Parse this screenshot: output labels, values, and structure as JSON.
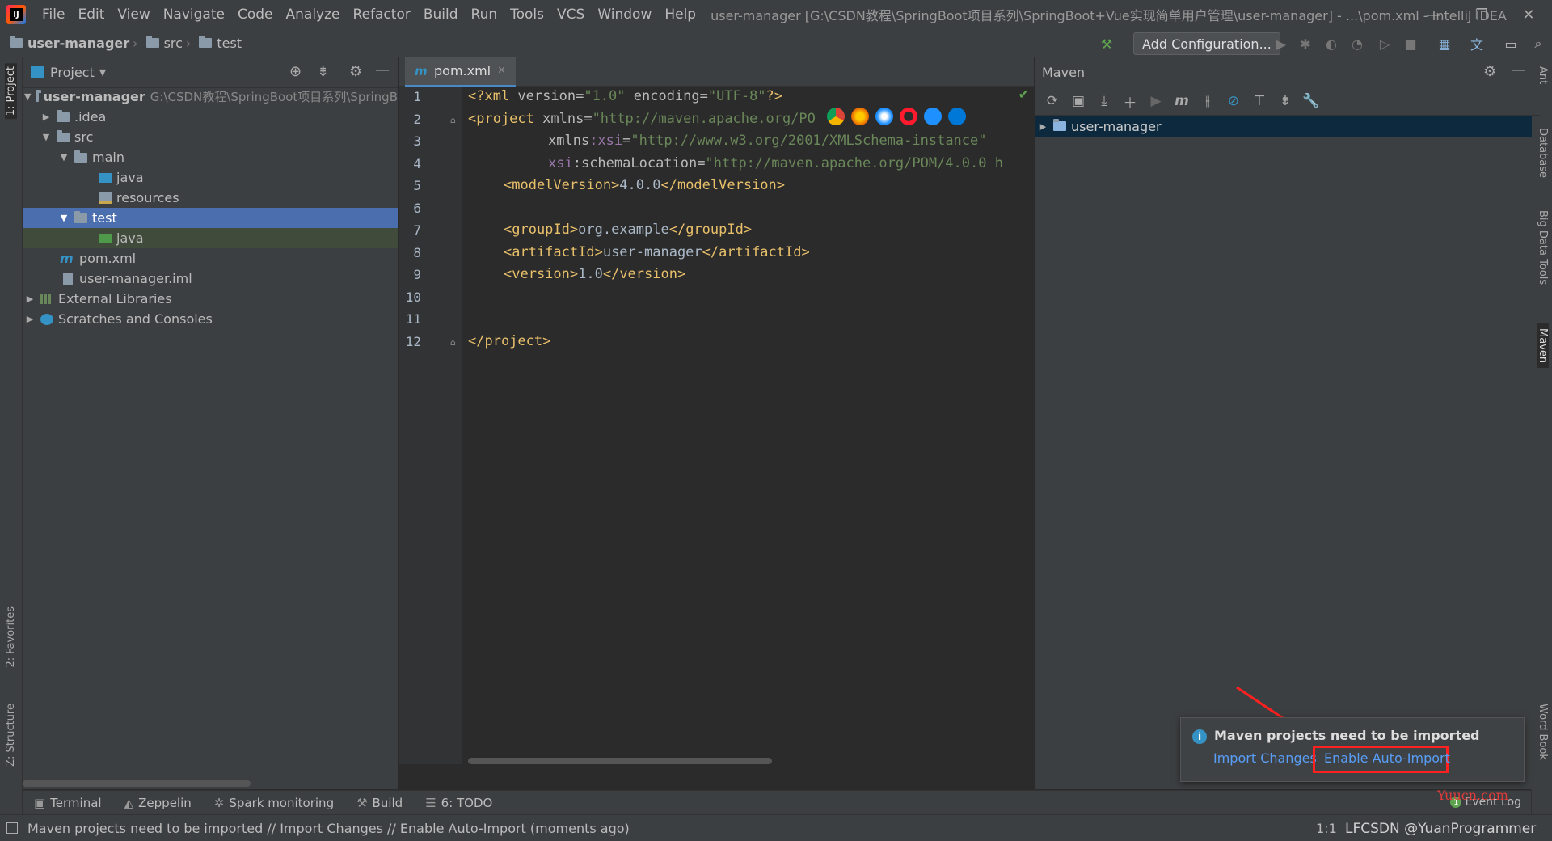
{
  "app": {
    "title": "user-manager [G:\\CSDN教程\\SpringBoot项目系列\\SpringBoot+Vue实现简单用户管理\\user-manager] - ...\\pom.xml - IntelliJ IDEA",
    "logo_text": "IJ"
  },
  "menu": [
    "File",
    "Edit",
    "View",
    "Navigate",
    "Code",
    "Analyze",
    "Refactor",
    "Build",
    "Run",
    "Tools",
    "VCS",
    "Window",
    "Help"
  ],
  "window_controls": [
    "—",
    "❐",
    "✕"
  ],
  "breadcrumb": [
    "user-manager",
    "src",
    "test"
  ],
  "toolbar": {
    "add_configuration": "Add Configuration..."
  },
  "left_stripe": {
    "project": "1: Project",
    "favorites": "2: Favorites",
    "structure": "Z: Structure"
  },
  "right_stripe": {
    "ant": "Ant",
    "database": "Database",
    "bigdata": "Big Data Tools",
    "maven": "Maven",
    "wordbook": "Word Book"
  },
  "project_panel": {
    "title": "Project",
    "tree": [
      {
        "label": "user-manager",
        "path": "G:\\CSDN教程\\SpringBoot项目系列\\SpringB"
      },
      {
        "label": ".idea"
      },
      {
        "label": "src"
      },
      {
        "label": "main"
      },
      {
        "label": "java"
      },
      {
        "label": "resources"
      },
      {
        "label": "test"
      },
      {
        "label": "java"
      },
      {
        "label": "pom.xml"
      },
      {
        "label": "user-manager.iml"
      },
      {
        "label": "External Libraries"
      },
      {
        "label": "Scratches and Consoles"
      }
    ]
  },
  "editor": {
    "tab": "pom.xml",
    "line_numbers": [
      "1",
      "2",
      "3",
      "4",
      "5",
      "6",
      "7",
      "8",
      "9",
      "10",
      "11",
      "12"
    ],
    "lines": {
      "l1": {
        "a": "<?xml ",
        "b": "version",
        "c": "=",
        "d": "\"1.0\"",
        "e": " encoding",
        "f": "=",
        "g": "\"UTF-8\"",
        "h": "?>"
      },
      "l2": {
        "a": "<project ",
        "b": "xmlns",
        "c": "=",
        "d": "\"http://maven.apache.org/PO"
      },
      "l3": {
        "a": "xmlns",
        "b": ":xsi",
        "c": "=",
        "d": "\"http://www.w3.org/2001/XMLSchema-instance\""
      },
      "l4": {
        "a": "xsi",
        "b": ":schemaLocation",
        "c": "=",
        "d": "\"http://maven.apache.org/POM/4.0.0 h"
      },
      "l5": {
        "a": "<modelVersion>",
        "b": "4.0.0",
        "c": "</modelVersion>"
      },
      "l7": {
        "a": "<groupId>",
        "b": "org.example",
        "c": "</groupId>"
      },
      "l8": {
        "a": "<artifactId>",
        "b": "user-manager",
        "c": "</artifactId>"
      },
      "l9": {
        "a": "<version>",
        "b": "1.0",
        "c": "</version>"
      },
      "l12": {
        "a": "</project>"
      }
    }
  },
  "maven_panel": {
    "title": "Maven",
    "project": "user-manager"
  },
  "notification": {
    "title": "Maven projects need to be imported",
    "import_changes": "Import Changes",
    "enable_auto_import": "Enable Auto-Import"
  },
  "bottom_tools": [
    "Terminal",
    "Zeppelin",
    "Spark monitoring",
    "Build",
    "6: TODO"
  ],
  "event_log": {
    "count": "1",
    "label": "Event Log"
  },
  "status": {
    "message": "Maven projects need to be imported // Import Changes // Enable Auto-Import (moments ago)",
    "position": "1:1",
    "watermark": "LFCSDN @YuanProgrammer",
    "site_watermark": "Yuucn.com"
  },
  "colors": {
    "accent": "#4b6eaf",
    "link": "#589df6",
    "highlight_box": "#ff2020"
  }
}
